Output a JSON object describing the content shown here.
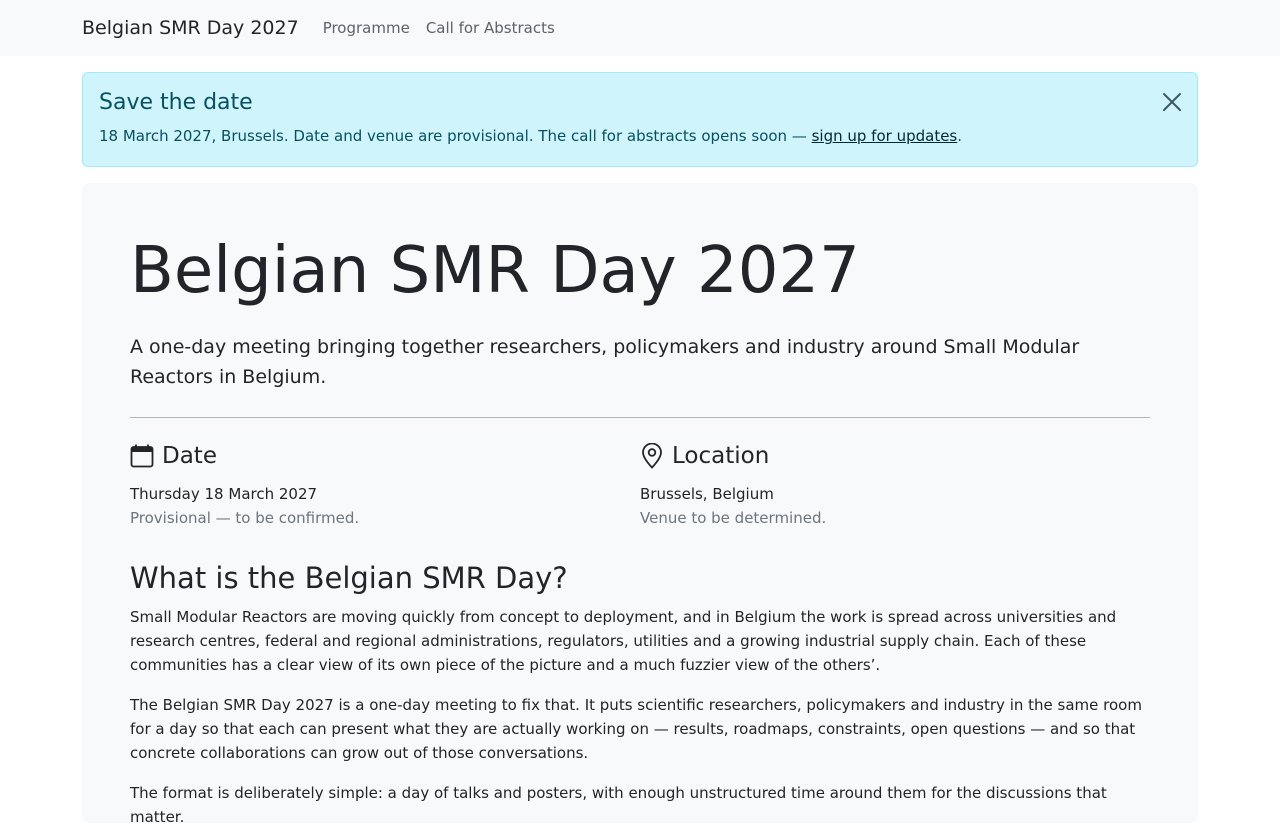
{
  "navbar": {
    "brand": "Belgian SMR Day 2027",
    "links": [
      "Programme",
      "Call for Abstracts"
    ]
  },
  "alert": {
    "title": "Save the date",
    "text": "18 March 2027, Brussels. Date and venue are provisional. The call for abstracts opens soon — ",
    "link": "sign up for updates",
    "after": ".",
    "close_icon": "close-icon"
  },
  "hero": {
    "title": "Belgian SMR Day 2027",
    "lead": "A one-day meeting bringing together researchers, policymakers and industry around Small Modular Reactors in Belgium."
  },
  "date": {
    "icon": "calendar-icon",
    "heading": "Date",
    "main": "Thursday 18 March 2027",
    "sub": "Provisional — to be confirmed."
  },
  "location": {
    "icon": "map-pin-icon",
    "heading": "Location",
    "main": "Brussels, Belgium",
    "sub": "Venue to be determined."
  },
  "about": {
    "title": "What is the Belgian SMR Day?",
    "paragraphs": [
      "Small Modular Reactors are moving quickly from concept to deployment, and in Belgium the work is spread across universities and research centres, federal and regional administrations, regulators, utilities and a growing industrial supply chain. Each of these communities has a clear view of its own piece of the picture and a much fuzzier view of the others’.",
      "The Belgian SMR Day 2027 is a one-day meeting to fix that. It puts scientific researchers, policymakers and industry in the same room for a day so that each can present what they are actually working on — results, roadmaps, constraints, open questions — and so that concrete collaborations can grow out of those conversations.",
      "The format is deliberately simple: a day of talks and posters, with enough unstructured time around them for the discussions that matter."
    ]
  },
  "colors": {
    "alert_bg": "#cff4fc",
    "alert_text": "#055160",
    "hero_bg": "#f8f9fa",
    "navbar_bg": "#f8f9fa"
  }
}
